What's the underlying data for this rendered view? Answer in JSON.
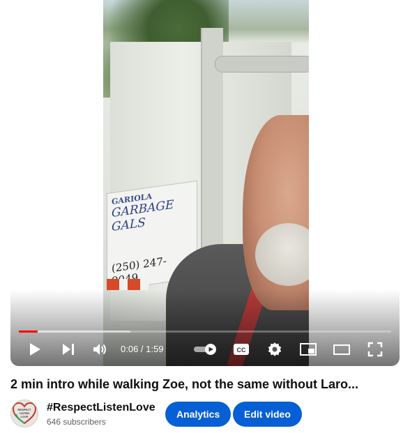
{
  "player": {
    "current_time": "0:06",
    "time_separator": " / ",
    "duration": "1:59",
    "progress_fraction": 0.05,
    "buffered_fraction": 0.3,
    "progress_color": "#ff0000",
    "video_sign": {
      "line1": "GARIOLA",
      "brand": "GARBAGE GALS",
      "phone": "(250) 247-9049"
    },
    "controls": {
      "play_icon": "play-icon",
      "next_icon": "next-icon",
      "volume_icon": "volume-icon",
      "autoplay_icon": "autoplay-toggle-icon",
      "cc_icon": "closed-captions-icon",
      "settings_icon": "gear-icon",
      "miniplayer_icon": "miniplayer-icon",
      "theater_icon": "theater-mode-icon",
      "fullscreen_icon": "fullscreen-icon"
    }
  },
  "video": {
    "title": "2 min intro while walking Zoe, not the same without Laro..."
  },
  "channel": {
    "name": "#RespectListenLove",
    "subscribers": "646 subscribers",
    "avatar_text": "RESPECT LISTEN LOVE"
  },
  "actions": {
    "analytics_label": "Analytics",
    "edit_label": "Edit video",
    "button_color": "#065fd4"
  }
}
